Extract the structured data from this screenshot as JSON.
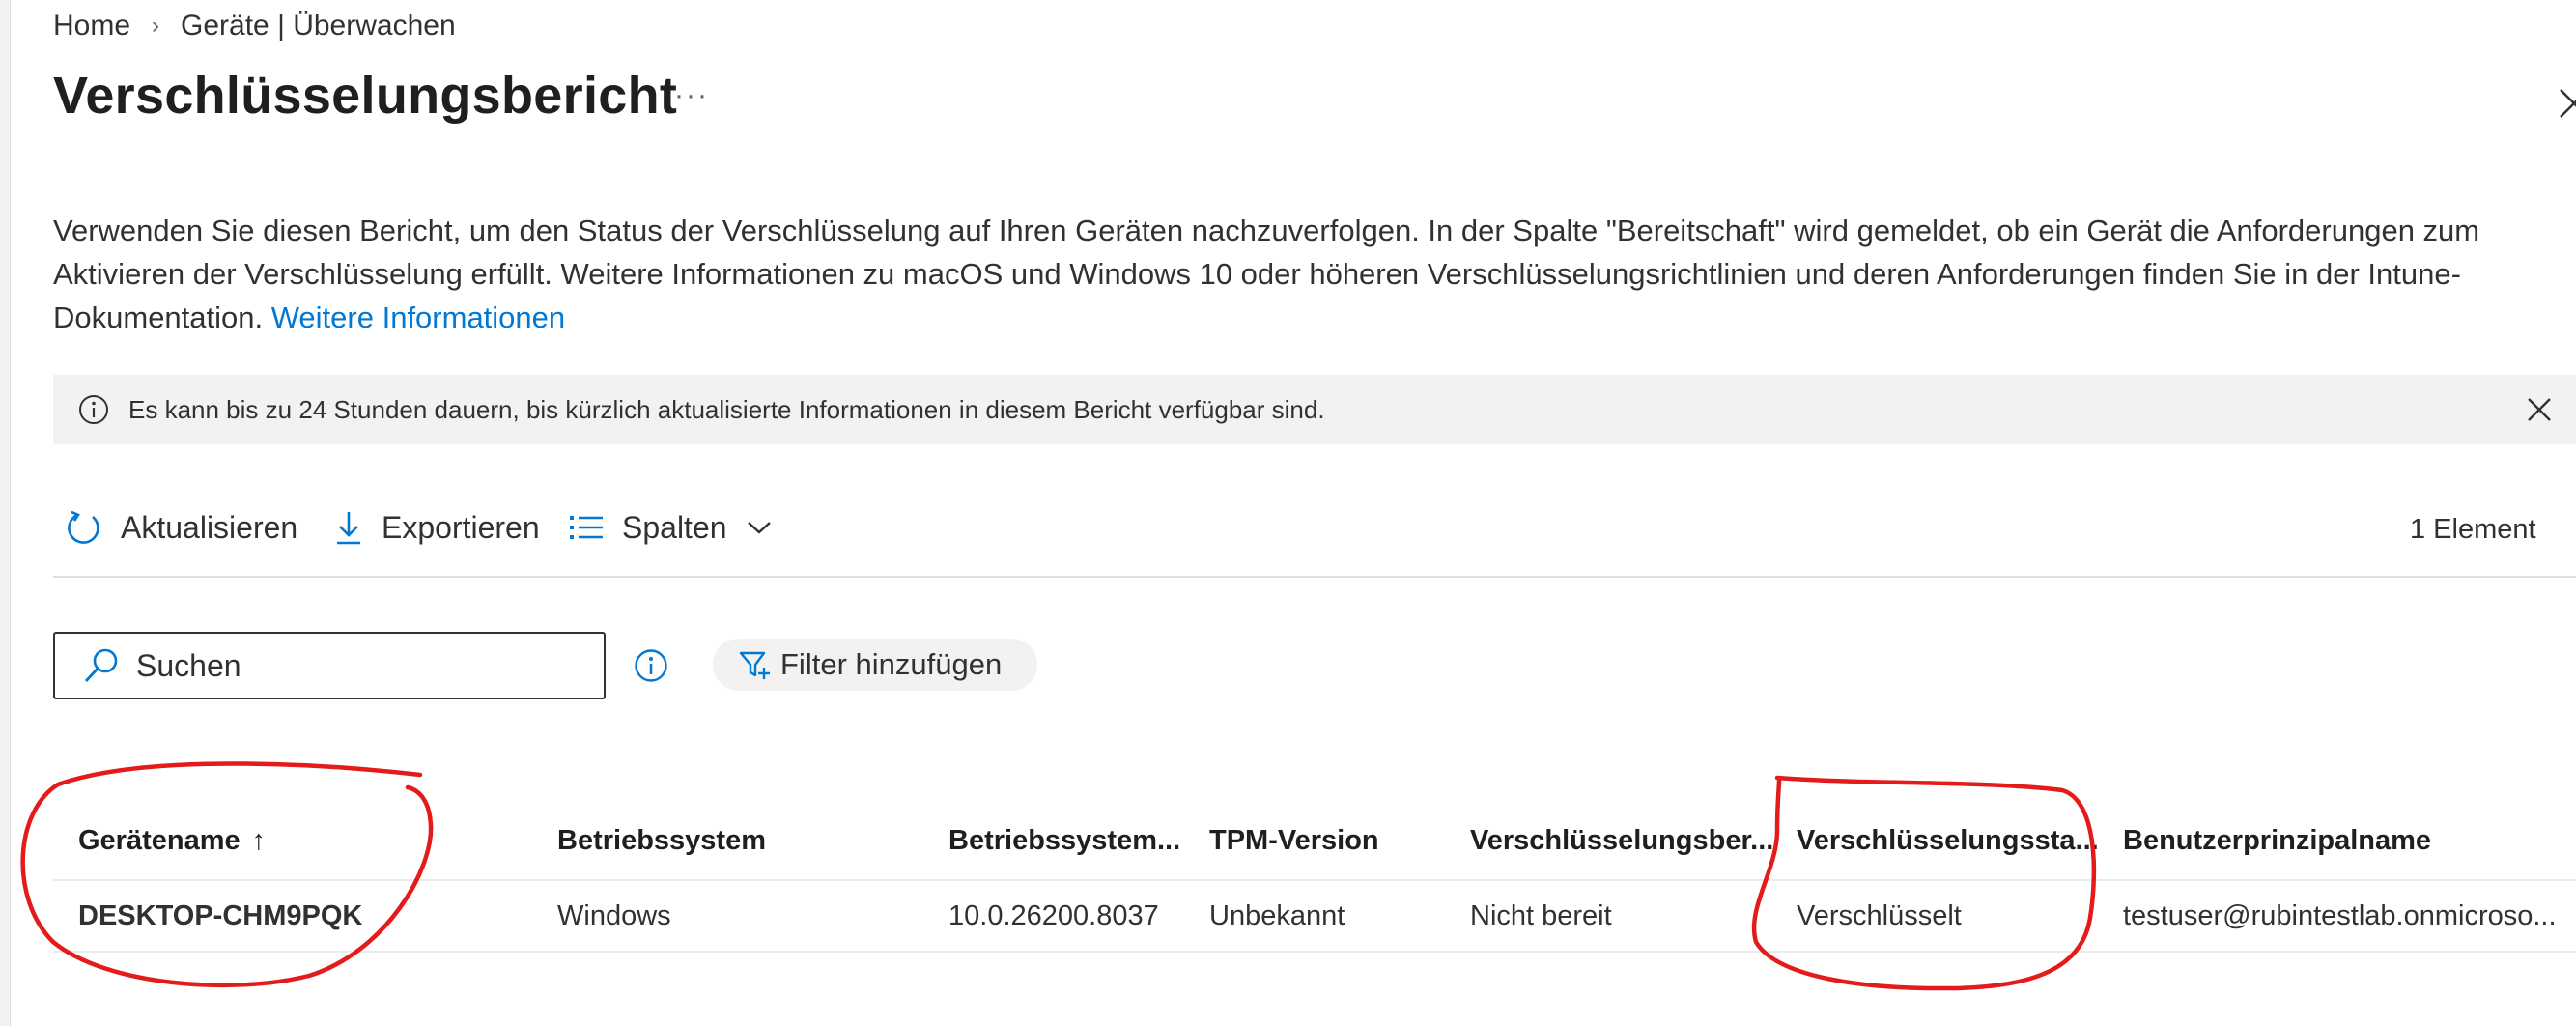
{
  "breadcrumb": {
    "home": "Home",
    "separator": "›",
    "current": "Geräte | Überwachen"
  },
  "page": {
    "title": "Verschlüsselungsbericht",
    "more": "···"
  },
  "description": {
    "text": "Verwenden Sie diesen Bericht, um den Status der Verschlüsselung auf Ihren Geräten nachzuverfolgen. In der Spalte \"Bereitschaft\" wird gemeldet, ob ein Gerät die Anforderungen zum Aktivieren der Verschlüsselung erfüllt. Weitere Informationen zu macOS und Windows 10 oder höheren Verschlüsselungsrichtlinien und deren Anforderungen finden Sie in der Intune-Dokumentation. ",
    "link": "Weitere Informationen"
  },
  "banner": {
    "message": "Es kann bis zu 24 Stunden dauern, bis kürzlich aktualisierte Informationen in diesem Bericht verfügbar sind."
  },
  "toolbar": {
    "refresh": "Aktualisieren",
    "export": "Exportieren",
    "columns": "Spalten",
    "count": "1 Element"
  },
  "search": {
    "placeholder": "Suchen"
  },
  "filter": {
    "label": "Filter hinzufügen"
  },
  "table": {
    "columns": [
      "Gerätename",
      "Betriebssystem",
      "Betriebssystem...",
      "TPM-Version",
      "Verschlüsselungsber...",
      "Verschlüsselungssta...",
      "Benutzerprinzipalname"
    ],
    "sort_indicator": "↑",
    "rows": [
      [
        "DESKTOP-CHM9PQK",
        "Windows",
        "10.0.26200.8037",
        "Unbekannt",
        "Nicht bereit",
        "Verschlüsselt",
        "testuser@rubintestlab.onmicroso..."
      ]
    ]
  },
  "colors": {
    "accent": "#0078d4",
    "annotation": "#e31b1b",
    "banner_bg": "#f3f2f1"
  }
}
